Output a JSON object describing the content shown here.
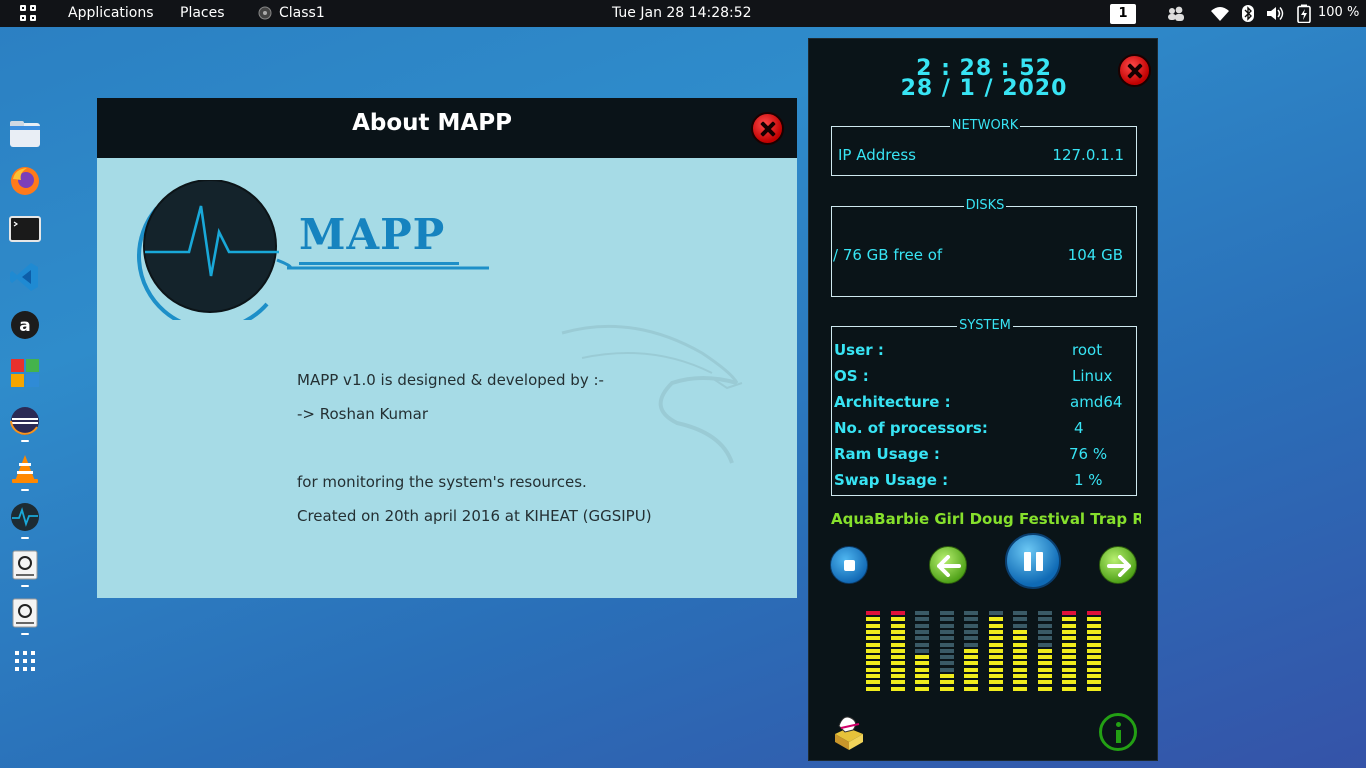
{
  "topbar": {
    "applications": "Applications",
    "places": "Places",
    "active_app": "Class1",
    "clock": "Tue Jan 28  14:28:52",
    "workspace": "1",
    "battery": "100 %"
  },
  "dock": {
    "items": [
      "files",
      "firefox",
      "terminal",
      "vscode",
      "amazon",
      "office",
      "eclipse",
      "vlc",
      "mapp",
      "drive",
      "drive",
      "show-apps"
    ]
  },
  "about": {
    "title": "About MAPP",
    "logo_text": "MAPP",
    "line1": "MAPP v1.0 is designed & developed by :-",
    "line2": "-> Roshan Kumar",
    "line3": "for monitoring the system's resources.",
    "line4": "Created on 20th april 2016 at KIHEAT (GGSIPU)"
  },
  "widget": {
    "time": "2 : 28 : 52",
    "date": "28 / 1 / 2020",
    "network": {
      "legend": "NETWORK",
      "ip_label": "IP Address",
      "ip_value": "127.0.1.1"
    },
    "disks": {
      "legend": "DISKS",
      "label": "/ 76 GB free of",
      "value": "104 GB"
    },
    "system": {
      "legend": "SYSTEM",
      "rows": [
        {
          "label": "User :",
          "value": "root"
        },
        {
          "label": "OS :",
          "value": "Linux"
        },
        {
          "label": "Architecture :",
          "value": "amd64"
        },
        {
          "label": "No. of processors:",
          "value": "4"
        },
        {
          "label": "Ram Usage :",
          "value": "76 %"
        },
        {
          "label": "Swap Usage :",
          "value": "1 %"
        }
      ]
    },
    "song": "AquaBarbie Girl Doug Festival Trap R...",
    "equalizer_levels": [
      1.0,
      1.0,
      0.45,
      0.25,
      0.55,
      0.9,
      0.75,
      0.55,
      1.0,
      1.0
    ],
    "colors": {
      "accent": "#38e4f4",
      "song": "#86e02c",
      "eq_bar": "#f0ec1c",
      "eq_peak": "#e0103a",
      "eq_off": "#3a5a66"
    }
  }
}
